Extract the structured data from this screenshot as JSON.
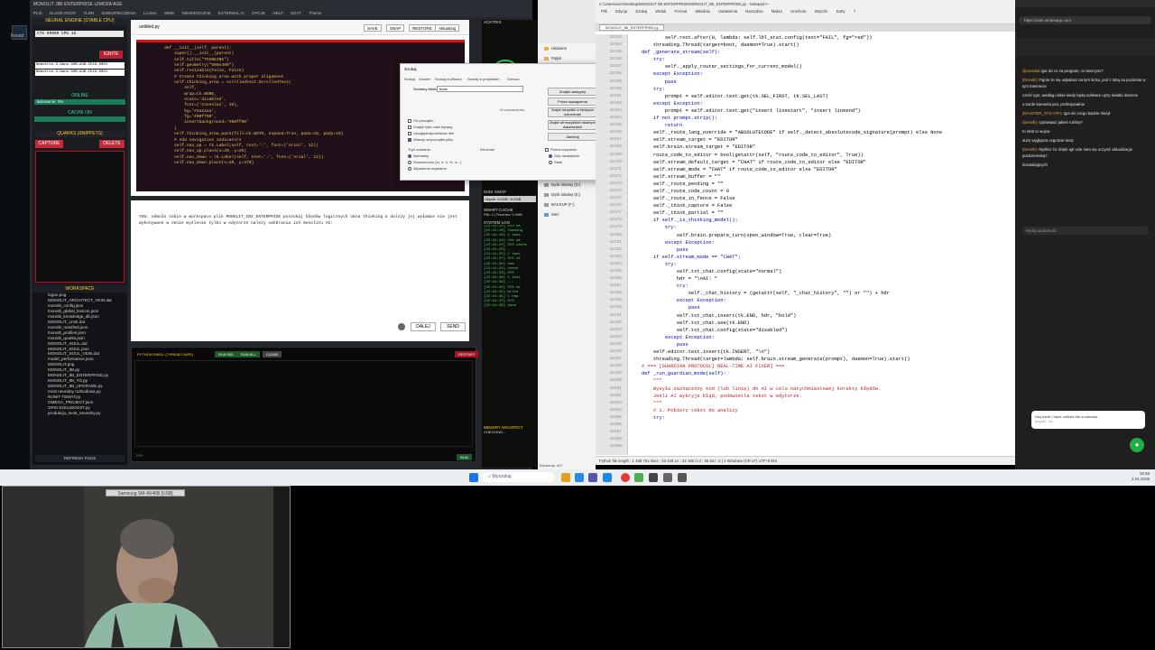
{
  "strip": {
    "lines": [
      "Found"
    ]
  },
  "ide": {
    "title": "MONOLIT JIBI ENTERPRISE v2MOZA AGE",
    "menu": [
      "PLIK",
      "KLOSK ROOT",
      "TLRN",
      "ZABEZPIECZENIA",
      "LLAMA",
      "MNIE",
      "NIEWIDOCZNE",
      "EXTERNAL AI",
      "OPCJE",
      "HELP",
      "EDYT",
      "Theme"
    ],
    "engine_label": "NEURAL ENGINE (STABLE CPU)",
    "ctx": "CTX 99999  CPU 16",
    "ignite": "IGNITE",
    "models": [
      "Nemotron-3-Nano-30B-A3B-IE16-0001",
      "Nemotron-3-Nano-30B-A3B-IE16-0001"
    ],
    "online": "ONLINE",
    "loading": "ładowanie: 0%",
    "cache": "CACHE ON",
    "quarks": "QUARKS (SNIPPETS)",
    "capture": "CAPTURE",
    "delete": "DELETE",
    "workspace": "WORKSPACE",
    "files": [
      "logo1.png",
      "MONOLIT_ARCHITECT_VEIN.dat",
      "monolit_config.json",
      "monolit_global_lexicon.json",
      "monolit_knowledge_db.json",
      "MONOLIT_LIVE.dat",
      "monolit_manifest.json",
      "monolit_profiles.json",
      "monolit_quarks.json",
      "MONOLIT_SOUL.dat",
      "MONOLIT_SOUL.json",
      "MONOLIT_SOUL_VEIN.dat",
      "model_performance.json",
      "MONOLIT.png",
      "MONOLIT_IBI.py",
      "MONOLIT_IBI_ENTERPRISE.py",
      "MONOLIT_IBI_TO.py",
      "MONOLIT_IBI_UPGRADE.py",
      "most neuralny rozbudowa.py",
      "NOWY TEMAT.py",
      "OMEGA_PROJECT.json",
      "OPIS-SOULBOOST.py",
      "produkcja_most_neuralny.py"
    ],
    "refresh": "REFRESH FILES",
    "editor": {
      "filename": "untitled.py",
      "buttons": [
        "SAVE",
        "SNAP",
        "RESTORE",
        "Aktualizuj"
      ],
      "code": [
        "    def __init__(self, parent):",
        "        super().__init__(parent)",
        "        self.title(\"THINKING\")",
        "        self.geometry(\"600x400\")",
        "        self.resizable(False, False)",
        "",
        "        # Create thinking area with proper alignment",
        "        self.thinking_area = scrolledtext.ScrolledText(",
        "            self,",
        "            wrap=tk.WORD,",
        "            state='disabled',",
        "            font=('Consolas', 10),",
        "            bg='#1a1a1a',",
        "            fg='#00ff00',",
        "            insertbackground='#00ff00'",
        "        )",
        "        self.thinking_area.pack(fill=tk.BOTH, expand=True, padx=10, pady=10)",
        "",
        "        # Add navigation indicators",
        "        self.nav_up = tk.Label(self, text='↑', font=('Arial', 12))",
        "        self.nav_up.place(x=20, y=20)",
        "        self.nav_down = tk.Label(self, text='↓', font=('Arial', 12))",
        "        self.nav_down.place(x=20, y=370)"
      ]
    },
    "chat_text": "YOU: odwoło sobie w workspace plik MONOLIT_IBI_ENTERPRISE poszukaj błędów logicznych okna thinking a dalszy jej wyłamie nie jest wykonywane w oknie myślenie tylko w edytorze należy odebrania ich monolitu AI:",
    "chat_buttons": [
      "DALEJ",
      "SEND"
    ],
    "shell_label": "PYTHON SHELL (THREAD SAFE)",
    "shell_buttons": [
      "RUN SEL",
      "RUN ALL",
      "CLEAR",
      "RESTART"
    ],
    "shell_prompt": ">>>",
    "run": "RUN"
  },
  "middle": {
    "activity": "ACKTRIX",
    "disk": "DISK SWAP",
    "disk_use": "Użycie: 0.0GB / 0.0GB",
    "smart": "SMART CACHE",
    "smart_detail": "Plik: 2 | Rozmiar: 0.0MB",
    "syslog": "SYSTEM LOG",
    "log": [
      "[22:41:15] SYS OK",
      "[22:41:16] loading",
      "[22:41:18] 1 task",
      "[22:41:19] chk ok",
      "[22:41:22] SYS cache",
      "[22:41:23] ... ",
      "[22:41:25] 1 task",
      "[22:41:27] SYS ok",
      "[22:41:30] new",
      "[22:41:31] check",
      "[22:41:33] SYS",
      "[22:41:36] 1 task",
      "[22:41:38] ...",
      "[22:41:40] SYS ok",
      "[22:41:42] write",
      "[22:41:45] 1 new",
      "[22:41:47] SYS",
      "[22:41:49] done"
    ],
    "memory": "MEMORY ARCHITECT",
    "memory_status": "CHECKING..."
  },
  "explorer": {
    "items": [
      "Ulubione",
      "Pulpit",
      "Pobrane",
      "Dokumenty",
      "Obrazy",
      "Muzyka",
      "Wideo",
      "MONOLIT",
      "MONOLIT AI",
      "monolit_quarks",
      "COSMIC_WORKSPACE",
      "Ten komputer",
      "Dysk lokalny (C:)",
      "Dysk lokalny (D:)",
      "Dysk lokalny (E:)",
      "BACKUP (F:)",
      "Sieć"
    ],
    "status": "Elementy: 407"
  },
  "dialog": {
    "title": "Szukaj",
    "tabs": [
      "Szukaj",
      "Zamień",
      "Szukaj w plikach",
      "Szukaj w projektach",
      "Oznacz"
    ],
    "find_label": "Szukany tekst:",
    "find_value": "brain",
    "buttons": [
      "Znajdź następny",
      "Policz wystąpienia",
      "Znajdź wszystkie w bieżącym dokumencie",
      "Znajdź we wszystkich otwartych dokumentach",
      "Zamknij"
    ],
    "options": [
      "Od początku",
      "Znajdź tylko całe wyrazy",
      "Uwzględniaj wielkość liter",
      "Wracaj na początek pliku"
    ],
    "mode_label": "Tryb szukania",
    "modes": [
      "Normalny",
      "Rozszerzony (\\n, \\r, \\t, \\0, \\x...)",
      "Wyrażenia regularne"
    ],
    "direction": "Kierunek",
    "transparency": "Przezroczystość",
    "trans_opts": [
      "Gdy nieaktywne",
      "Stale"
    ],
    "in_selection": "W zaznaczeniu"
  },
  "npp": {
    "title": "C:\\Users\\user\\Desktop\\MONOLIT IBI ENTERPRISE\\MONOLIT_IBI_ENTERPRISE.py - Notepad++",
    "menu": [
      "Plik",
      "Edycja",
      "Szukaj",
      "Widok",
      "Format",
      "Składnia",
      "Ustawienia",
      "Narzędzia",
      "Makra",
      "Uruchom",
      "Wtyczki",
      "Karty",
      "?"
    ],
    "tab": "MONOLIT_IBI_ENTERPRISE.py",
    "lines": [
      "22153",
      "22154",
      "22155",
      "22156",
      "22157",
      "22158",
      "22159",
      "22160",
      "22161",
      "22162",
      "22163",
      "22164",
      "22165",
      "22166",
      "22167",
      "22168",
      "22169",
      "22170",
      "22171",
      "22172",
      "22173",
      "22174",
      "22175",
      "22176",
      "22177",
      "22178",
      "22179",
      "22180",
      "22181",
      "22182",
      "22183",
      "22184",
      "22185",
      "22186",
      "22187",
      "22188",
      "22189",
      "22190",
      "22191",
      "22192",
      "22193",
      "22194",
      "22195",
      "22196",
      "22197",
      "22198",
      "22199",
      "22200",
      "22201",
      "22202",
      "22203",
      "22204",
      "22205",
      "22206",
      "22207",
      "22208",
      "22209"
    ],
    "code": [
      "            self.root.after(0, lambda: self.lbl_stat.config(text=\"FAIL\", fg=\"red\"))",
      "",
      "        threading.Thread(target=boot, daemon=True).start()",
      "",
      "    def _generate_stream(self):",
      "        try:",
      "            self._apply_router_settings_for_current_model()",
      "        except Exception:",
      "            pass",
      "        try:",
      "            prompt = self.editor.text.get(tk.SEL_FIRST, tk.SEL_LAST)",
      "        except Exception:",
      "            prompt = self.editor.text.get(\"insert linestart\", \"insert lineend\")",
      "        if not prompt.strip():",
      "            return",
      "        self._route_lang_override = \"ABSOLUTECODE\" if self._detect_absolutecode_signature(prompt) else None",
      "        self.stream_target = \"EDITOR\"",
      "        self.brain.stream_target = \"EDITOR\"",
      "        route_code_to_editor = bool(getattr(self, \"route_code_to_editor\", True))",
      "        self.stream_default_target = \"CHAT\" if route_code_to_editor else \"EDITOR\"",
      "        self.stream_mode = \"CHAT\" if route_code_to_editor else \"EDITOR\"",
      "        self.stream_buffer = \"\"",
      "        self._route_pending = \"\"",
      "        self._route_code_count = 0",
      "        self._route_in_fence = False",
      "        self._think_capture = False",
      "        self._think_partial = \"\"",
      "        if self._is_thinking_model():",
      "            try:",
      "                self.brain.prepare_turn(open_window=True, clear=True)",
      "            except Exception:",
      "                pass",
      "        if self.stream_mode == \"CHAT\":",
      "            try:",
      "                self.txt_chat.config(state=\"normal\")",
      "                hdr = \"\\nAI: \"",
      "                try:",
      "                    self._chat_history = (getattr(self, \"_chat_history\", \"\") or \"\") + hdr",
      "                except Exception:",
      "                    pass",
      "                self.txt_chat.insert(tk.END, hdr, \"bold\")",
      "                self.txt_chat.see(tk.END)",
      "                self.txt_chat.config(state=\"disabled\")",
      "            except Exception:",
      "                pass",
      "        self.editor.text.insert(tk.INSERT, \"\\n\")",
      "        threading.Thread(target=lambda: self.brain.stream_generate(prompt), daemon=True).start()",
      "",
      "    # === [GUARDIAN PROTOCOL] REAL-TIME AI FIXER] ===",
      "    def _run_guardian_mode(self):",
      "        \"\"\"",
      "        Wysyła zaznaczony kod (lub linię) do AI w celu natychmiastowej korekty błędów.",
      "        Jeśli AI wykryje błąd, podświetla tekst w edytorze.",
      "        \"\"\"",
      "        # 1. Pobierz tekst do analizy",
      "        try:",
      ""
    ],
    "status": "Python file   length : 1 198 751   lines : 23 345     Ln : 22 186   Col : 35   Sel : 6 | 1     Windows (CR LF)   UTF-8   INS"
  },
  "browser": {
    "address": "https://web.whatsapp.com",
    "chats": [
      {
        "name": "@arasolid",
        "text": "igor do co za program, co tworzysz?"
      },
      {
        "name": "(Derwik):",
        "text": "Fajnie że się odpalasz na tym kicku, jest z tobą na poziomie w tym internecie"
      },
      {
        "name": "",
        "text": "cześć Igor, według ciebie kiedy będą software ujrzy światło dzienne"
      },
      {
        "name": "",
        "text": "o kurde kamerka jest, profesjonalnie"
      },
      {
        "name": "(MAJSTER_SYS.VIP.C",
        "text": "Igor do czego będzie służył"
      },
      {
        "name": "(Derwik):",
        "text": "Uprawiasz jakieś roślinę?"
      },
      {
        "name": "",
        "text": "to strat to wojna"
      },
      {
        "name": "",
        "text": "dużo wygląsza cegoście teraz"
      },
      {
        "name": "(Derwik):",
        "text": "Myślisz że dzięki ajé ucle nam się uczynić aktualizacja pozaziemską?"
      },
      {
        "name": "",
        "text": "dozwalających"
      }
    ],
    "message_placeholder": "Wyślij wiadomość",
    "notification": "Hey there I have noticed the moderator...",
    "notification_sub": "AmySt · zh"
  },
  "taskbar": {
    "search": "Wyszukaj",
    "time": "18:48",
    "date": "2.01.2026"
  },
  "cam": {
    "label": "Samsung SM-A546B [USB]"
  }
}
